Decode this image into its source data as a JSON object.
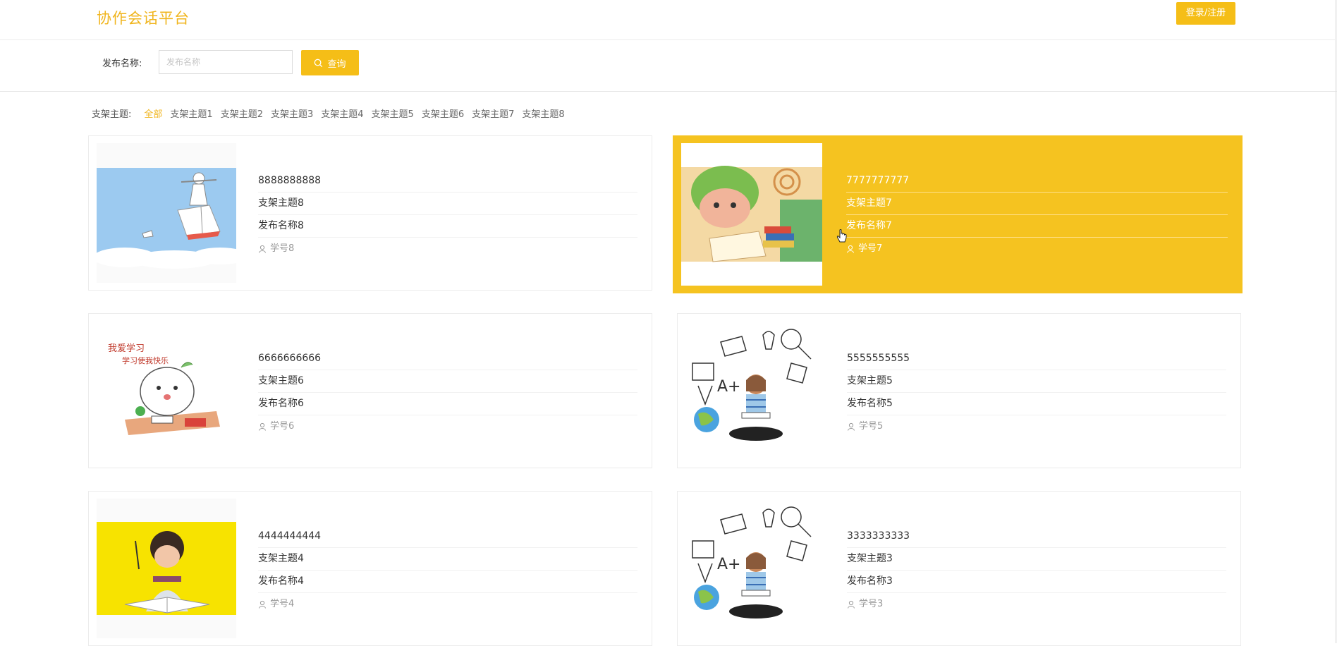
{
  "header": {
    "title": "协作会话平台",
    "login_label": "登录/注册"
  },
  "search": {
    "label": "发布名称:",
    "placeholder": "发布名称",
    "button_label": "查询"
  },
  "filter": {
    "label": "支架主题:",
    "items": [
      "全部",
      "支架主题1",
      "支架主题2",
      "支架主题3",
      "支架主题4",
      "支架主题5",
      "支架主题6",
      "支架主题7",
      "支架主题8"
    ],
    "active_index": 0
  },
  "cards": [
    {
      "title": "8888888888",
      "topic": "支架主题8",
      "name": "发布名称8",
      "student": "学号8",
      "image": "girl-on-book-sky"
    },
    {
      "title": "7777777777",
      "topic": "支架主题7",
      "name": "发布名称7",
      "student": "学号7",
      "image": "cartoon-reading-helmet",
      "highlighted": true
    },
    {
      "title": "6666666666",
      "topic": "支架主题6",
      "name": "发布名称6",
      "student": "学号6",
      "image": "cartoon-study-happy"
    },
    {
      "title": "5555555555",
      "topic": "支架主题5",
      "name": "发布名称5",
      "student": "学号5",
      "image": "girl-with-doodles"
    },
    {
      "title": "4444444444",
      "topic": "支架主题4",
      "name": "发布名称4",
      "student": "学号4",
      "image": "girl-writing-yellow"
    },
    {
      "title": "3333333333",
      "topic": "支架主题3",
      "name": "发布名称3",
      "student": "学号3",
      "image": "girl-with-doodles"
    }
  ],
  "theme": {
    "accent": "#f5be17",
    "accent_text": "#f0b51e"
  }
}
